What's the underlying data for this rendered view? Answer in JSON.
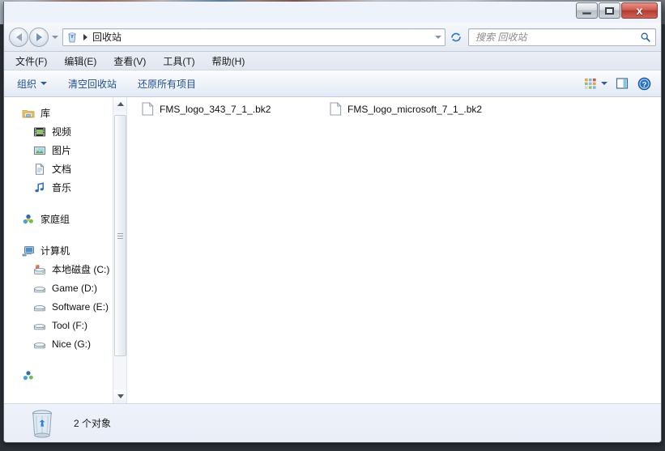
{
  "window": {
    "title": "",
    "controls": {
      "minimize": "最小化",
      "maximize": "最大化",
      "close": "关闭"
    }
  },
  "navbar": {
    "back_label": "后退",
    "forward_label": "前进",
    "history_label": "最近浏览的位置",
    "address_text": "回收站",
    "address_icon": "recycle-bin-icon",
    "refresh_label": "刷新",
    "search_placeholder": "搜索 回收站",
    "search_value": "",
    "search_icon": "search-icon"
  },
  "menubar": {
    "items": [
      {
        "label": "文件(F)"
      },
      {
        "label": "编辑(E)"
      },
      {
        "label": "查看(V)"
      },
      {
        "label": "工具(T)"
      },
      {
        "label": "帮助(H)"
      }
    ]
  },
  "commandbar": {
    "organize": "组织",
    "empty_recycle_bin": "清空回收站",
    "restore_all_items": "还原所有项目",
    "views_icon": "view-options-icon",
    "preview_pane_icon": "preview-pane-icon",
    "help_icon": "help-icon"
  },
  "sidebar": {
    "groups": [
      {
        "header": {
          "label": "库",
          "icon": "library-folder-icon"
        },
        "items": [
          {
            "label": "视频",
            "icon": "video-icon"
          },
          {
            "label": "图片",
            "icon": "pictures-icon"
          },
          {
            "label": "文档",
            "icon": "documents-icon"
          },
          {
            "label": "音乐",
            "icon": "music-icon"
          }
        ]
      },
      {
        "header": {
          "label": "家庭组",
          "icon": "homegroup-icon"
        },
        "items": []
      },
      {
        "header": {
          "label": "计算机",
          "icon": "computer-icon"
        },
        "items": [
          {
            "label": "本地磁盘 (C:)",
            "icon": "system-drive-icon"
          },
          {
            "label": "Game (D:)",
            "icon": "drive-icon"
          },
          {
            "label": "Software (E:)",
            "icon": "drive-icon"
          },
          {
            "label": "Tool (F:)",
            "icon": "drive-icon"
          },
          {
            "label": "Nice (G:)",
            "icon": "drive-icon"
          }
        ]
      }
    ]
  },
  "filelist": {
    "items": [
      {
        "name": "FMS_logo_343_7_1_.bk2",
        "icon": "generic-file-icon"
      },
      {
        "name": "FMS_logo_microsoft_7_1_.bk2",
        "icon": "generic-file-icon"
      }
    ]
  },
  "statusbar": {
    "icon": "recycle-bin-icon",
    "text": "2 个对象"
  },
  "colors": {
    "command_link": "#1f4f8b",
    "close_button": "#b23c30",
    "window_border": "#5b6772",
    "statusbar_bg": "#eef2fa"
  }
}
